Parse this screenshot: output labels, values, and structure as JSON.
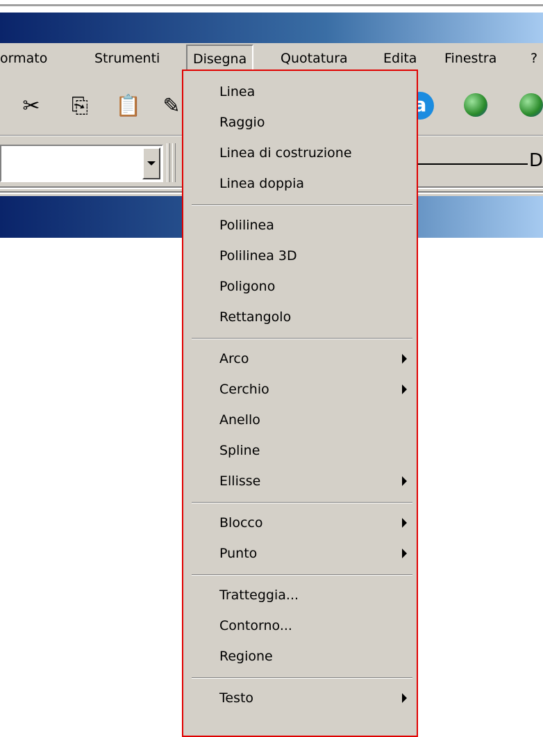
{
  "menubar": {
    "items": [
      "ormato",
      "Strumenti",
      "Disegna",
      "Quotatura",
      "Edita",
      "Finestra",
      "?"
    ],
    "active": "Disegna"
  },
  "toolbar": {
    "icons": [
      "cut-icon",
      "copy-icon",
      "paste-icon",
      "match-properties-icon",
      "a-icon",
      "globe-help-icon",
      "globe-icon"
    ]
  },
  "properties": {
    "cutoff_label": "D"
  },
  "dropdown": {
    "groups": [
      [
        {
          "label": "Linea",
          "submenu": false
        },
        {
          "label": "Raggio",
          "submenu": false
        },
        {
          "label": "Linea di costruzione",
          "submenu": false
        },
        {
          "label": "Linea doppia",
          "submenu": false
        }
      ],
      [
        {
          "label": "Polilinea",
          "submenu": false
        },
        {
          "label": "Polilinea 3D",
          "submenu": false
        },
        {
          "label": "Poligono",
          "submenu": false
        },
        {
          "label": "Rettangolo",
          "submenu": false
        }
      ],
      [
        {
          "label": "Arco",
          "submenu": true
        },
        {
          "label": "Cerchio",
          "submenu": true
        },
        {
          "label": "Anello",
          "submenu": false
        },
        {
          "label": "Spline",
          "submenu": false
        },
        {
          "label": "Ellisse",
          "submenu": true
        }
      ],
      [
        {
          "label": "Blocco",
          "submenu": true
        },
        {
          "label": "Punto",
          "submenu": true
        }
      ],
      [
        {
          "label": "Tratteggia...",
          "submenu": false
        },
        {
          "label": "Contorno...",
          "submenu": false
        },
        {
          "label": "Regione",
          "submenu": false
        }
      ],
      [
        {
          "label": "Testo",
          "submenu": true
        }
      ]
    ]
  },
  "colors": {
    "highlight_border": "#e00000",
    "menu_bg": "#d4d0c8",
    "titlebar": "#0a246a"
  }
}
